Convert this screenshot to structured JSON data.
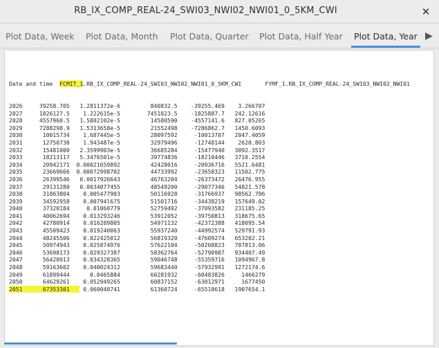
{
  "window": {
    "title": "RB_IX_COMP_REAL-24_SWI03_NWI02_NWI01_0_5KM_CWI",
    "close_glyph": "✕"
  },
  "tabs": [
    {
      "label": "Plot Data, Week",
      "active": false
    },
    {
      "label": "Plot Data, Month",
      "active": false
    },
    {
      "label": "Plot Data, Quarter",
      "active": false
    },
    {
      "label": "Plot Data, Half Year",
      "active": false
    },
    {
      "label": "Plot Data, Year",
      "active": true
    }
  ],
  "tab_scroll_glyph": "▶",
  "table": {
    "header": {
      "col0": "Date and time",
      "col1_highlight": "FCMIT_1",
      "col1_rest": ".RB_IX_COMP_REAL-24_SWI03_NWI02_NWI01_0_5KM_CWI",
      "col2": "FYMF_1.RB_IX_COMP_REAL-24_SWI03_NWI02_NWI01"
    },
    "rows": [
      [
        "2026",
        "39258.705",
        "1.2811372e-6",
        "840832.5",
        "-39255.469",
        "3.266707"
      ],
      [
        "2027",
        "1826127.5",
        "1.222615e-5",
        "7451023.5",
        "-1825887.7",
        "242.12616"
      ],
      [
        "2028",
        "4557960.5",
        "1.5802102e-5",
        "14580590",
        "-4557141.6",
        "827.05265"
      ],
      [
        "2029",
        "7288298.9",
        "1.5313658e-5",
        "21552498",
        "-7286862.7",
        "1450.6093"
      ],
      [
        "2030",
        "10015734",
        "1.687445e-5",
        "28097592",
        "-10013707",
        "2047.4059"
      ],
      [
        "2031",
        "12750738",
        "1.943487e-5",
        "32979496",
        "-12748144",
        "2620.803"
      ],
      [
        "2032",
        "15481000",
        "2.3599903e-5",
        "36685284",
        "-15477940",
        "3092.3517"
      ],
      [
        "2033",
        "18213117",
        "5.3476501e-5",
        "39774836",
        "-18210446",
        "3710.2554"
      ],
      [
        "2034",
        "20942171",
        "0.00021659892",
        "42428016",
        "-20936716",
        "5521.6481"
      ],
      [
        "2035",
        "23669666",
        "0.00072998702",
        "44733992",
        "-23658323",
        "11502.775"
      ],
      [
        "2036",
        "26399546",
        "0.0017926643",
        "46763204",
        "-26373472",
        "26476.955"
      ],
      [
        "2037",
        "29131280",
        "0.0034077455",
        "48549200",
        "-29077346",
        "54821.578"
      ],
      [
        "2038",
        "31863804",
        "0.005477903",
        "50116928",
        "-31766937",
        "98562.706"
      ],
      [
        "2039",
        "34592958",
        "0.00794l675",
        "51501716",
        "-34438219",
        "157649.02"
      ],
      [
        "2040",
        "37320184",
        "0.01060779",
        "52759492",
        "-37093582",
        "231185.25"
      ],
      [
        "2041",
        "40062694",
        "0.013293246",
        "53912052",
        "-39750813",
        "318675.65"
      ],
      [
        "2042",
        "42780914",
        "0.016289805",
        "54971132",
        "-42372388",
        "418095.54"
      ],
      [
        "2043",
        "45509423",
        "0.019240063",
        "55937240",
        "-44992574",
        "529791.93"
      ],
      [
        "2044",
        "48245506",
        "0.022425012",
        "56819320",
        "-47609274",
        "653202.21"
      ],
      [
        "2045",
        "50974943",
        "0.025874976",
        "57622104",
        "-50208823",
        "787813.06"
      ],
      [
        "2046",
        "53698173",
        "0.029327387",
        "58362764",
        "-52790987",
        "934407.49"
      ],
      [
        "2047",
        "56420913",
        "0.034328365",
        "59046748",
        "-55359716",
        "1094967.8"
      ],
      [
        "2048",
        "59163602",
        "0.040024312",
        "59683440",
        "-57932991",
        "1272174.6"
      ],
      [
        "2049",
        "61899444",
        "0.0465884",
        "60281932",
        "-60483826",
        "1466279"
      ],
      [
        "2050",
        "64629261",
        "0.052949265",
        "60837152",
        "-63012971",
        "1677450"
      ],
      [
        "2051",
        "67353301",
        "0.060040741",
        "61360724",
        "-65518618",
        "1907654.1"
      ]
    ],
    "highlighted_row_index": 25
  },
  "colors": {
    "highlight": "#f7f33a",
    "accent": "#4a90d9"
  }
}
